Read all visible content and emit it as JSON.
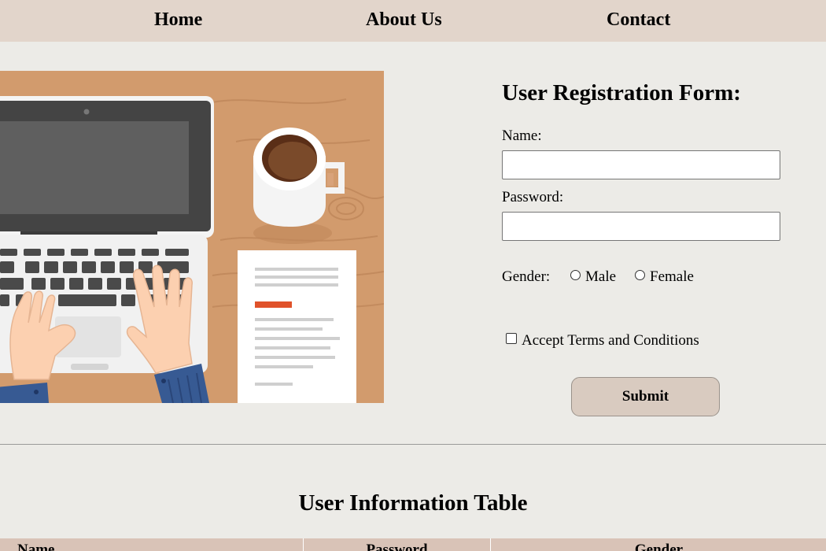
{
  "nav": {
    "home": "Home",
    "about": "About Us",
    "contact": "Contact"
  },
  "hero": {
    "description": "Flat illustration of a laptop with hands typing, a coffee cup and a document on a wooden desk"
  },
  "form": {
    "title": "User Registration Form:",
    "name_label": "Name:",
    "name_value": "",
    "password_label": "Password:",
    "password_value": "",
    "gender_label": "Gender:",
    "gender_options": [
      "Male",
      "Female"
    ],
    "gender_selected": null,
    "terms_label": "Accept Terms and Conditions",
    "terms_checked": false,
    "submit_label": "Submit"
  },
  "table": {
    "title": "User Information Table",
    "columns": [
      "Name",
      "Password",
      "Gender"
    ]
  },
  "colors": {
    "nav_bg": "#e2d5cb",
    "page_bg": "#ecebe7",
    "button_bg": "#d9cbc0",
    "table_header_bg": "#d9c3b7",
    "desk": "#d29b6d"
  }
}
